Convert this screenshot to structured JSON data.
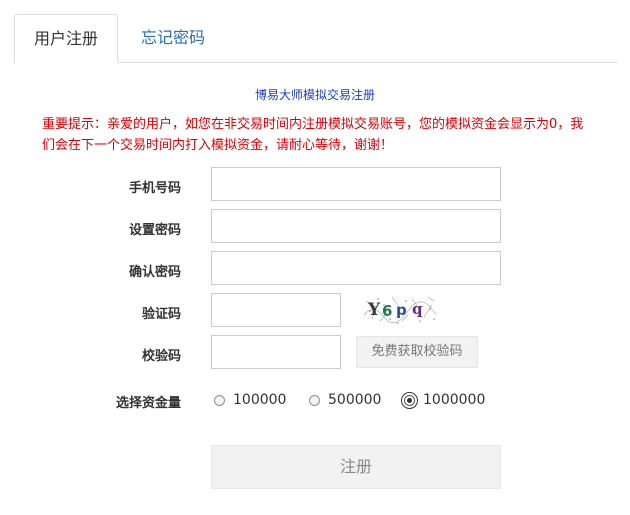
{
  "tabs": [
    {
      "label": "用户注册",
      "active": true
    },
    {
      "label": "忘记密码",
      "active": false
    }
  ],
  "form": {
    "title": "博易大师模拟交易注册",
    "notice": "重要提示：亲爱的用户，如您在非交易时间内注册模拟交易账号，您的模拟资金会显示为0，我们会在下一个交易时间内打入模拟资金，请耐心等待，谢谢！",
    "fields": {
      "phone": {
        "label": "手机号码",
        "value": "",
        "placeholder": ""
      },
      "password": {
        "label": "设置密码",
        "value": "",
        "placeholder": ""
      },
      "confirm": {
        "label": "确认密码",
        "value": "",
        "placeholder": ""
      },
      "captcha": {
        "label": "验证码",
        "value": "",
        "placeholder": "",
        "image_text": "Y6pq"
      },
      "verify": {
        "label": "校验码",
        "value": "",
        "placeholder": "",
        "button": "免费获取校验码"
      }
    },
    "fund": {
      "label": "选择资金量",
      "options": [
        "100000",
        "500000",
        "1000000"
      ],
      "selected": "1000000"
    },
    "submit_label": "注册"
  },
  "colors": {
    "tab_link": "#2a6ebd",
    "title": "#1a3ccc",
    "notice": "#e00000"
  }
}
